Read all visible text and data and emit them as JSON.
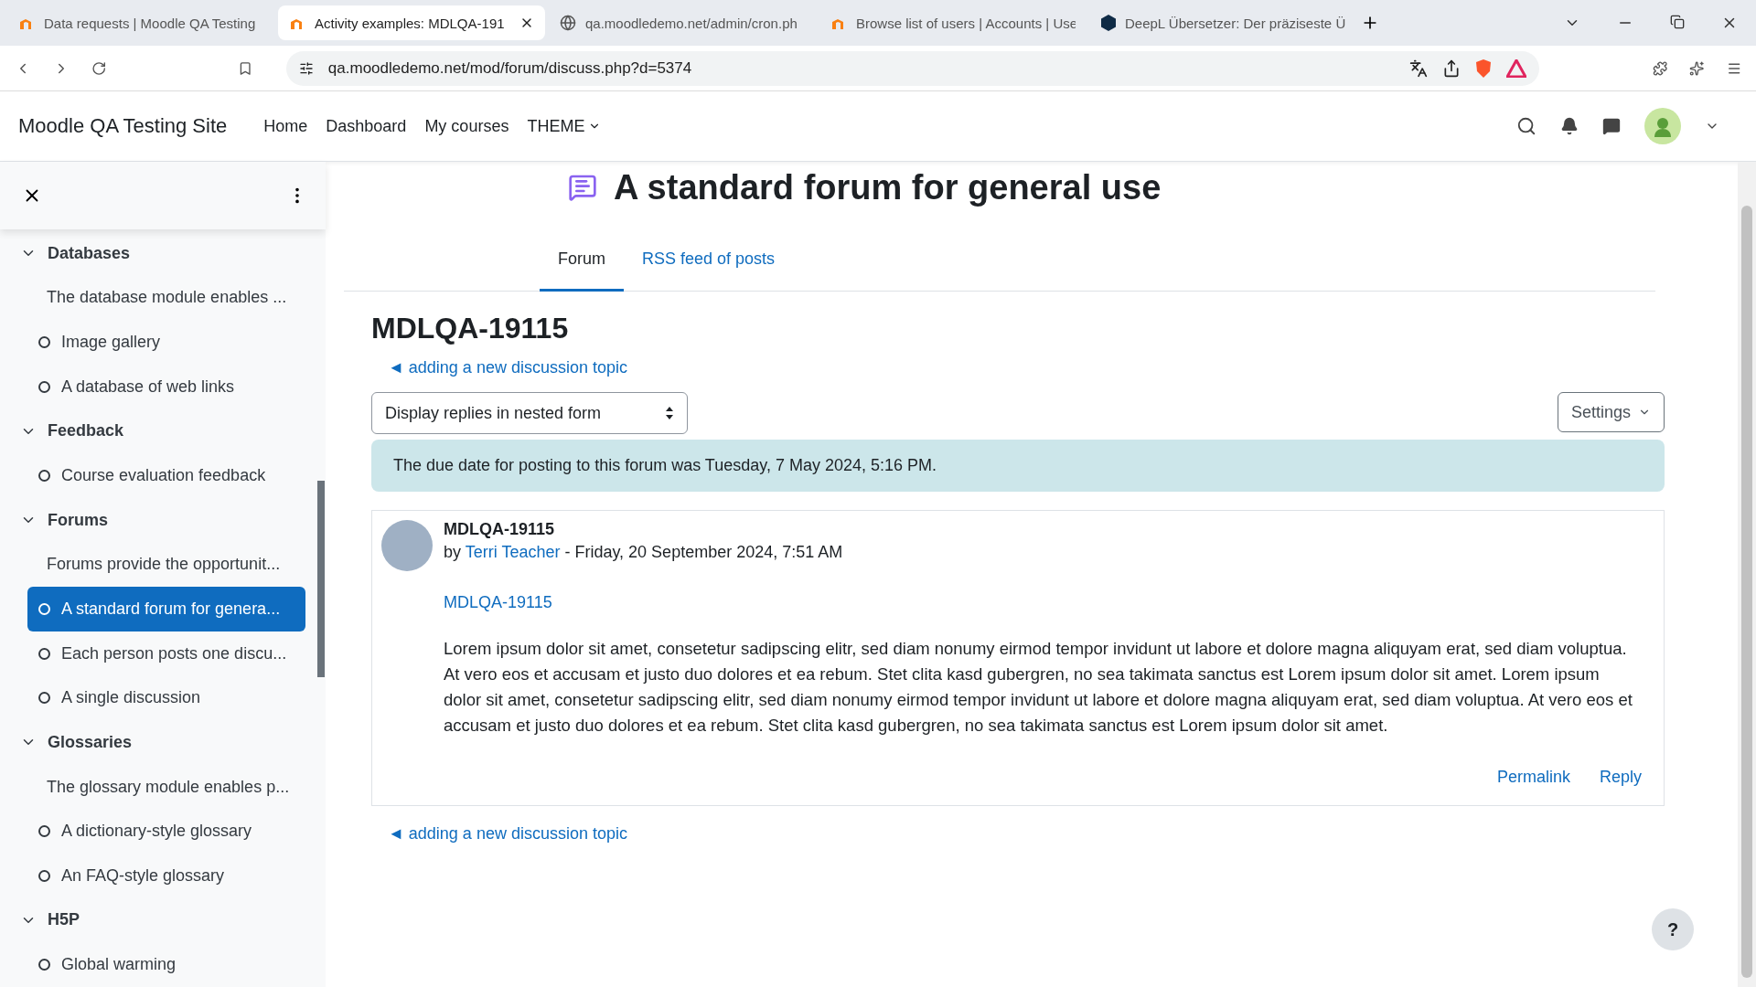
{
  "browser": {
    "tabs": [
      {
        "title": "Data requests | Moodle QA Testing",
        "selected": false
      },
      {
        "title": "Activity examples: MDLQA-191",
        "selected": true
      },
      {
        "title": "qa.moodledemo.net/admin/cron.ph",
        "selected": false
      },
      {
        "title": "Browse list of users | Accounts | Use",
        "selected": false
      },
      {
        "title": "DeepL Übersetzer: Der präziseste Ü",
        "selected": false
      }
    ],
    "url": "qa.moodledemo.net/mod/forum/discuss.php?d=5374"
  },
  "navbar": {
    "site_name": "Moodle QA Testing Site",
    "links": [
      {
        "label": "Home",
        "dropdown": false
      },
      {
        "label": "Dashboard",
        "dropdown": false
      },
      {
        "label": "My courses",
        "dropdown": false
      },
      {
        "label": "THEME",
        "dropdown": true
      }
    ]
  },
  "sidebar": {
    "sections": [
      {
        "title": "Databases",
        "expanded": true,
        "items": [
          {
            "kind": "description",
            "label": "The database module enables ...",
            "selected": false
          },
          {
            "kind": "activity",
            "label": "Image gallery",
            "selected": false
          },
          {
            "kind": "activity",
            "label": "A database of web links",
            "selected": false
          }
        ]
      },
      {
        "title": "Feedback",
        "expanded": true,
        "items": [
          {
            "kind": "activity",
            "label": "Course evaluation feedback",
            "selected": false
          }
        ]
      },
      {
        "title": "Forums",
        "expanded": true,
        "items": [
          {
            "kind": "description",
            "label": "Forums provide the opportunit...",
            "selected": false
          },
          {
            "kind": "activity",
            "label": "A standard forum for genera...",
            "selected": true
          },
          {
            "kind": "activity",
            "label": "Each person posts one discu...",
            "selected": false
          },
          {
            "kind": "activity",
            "label": "A single discussion",
            "selected": false
          }
        ]
      },
      {
        "title": "Glossaries",
        "expanded": true,
        "items": [
          {
            "kind": "description",
            "label": "The glossary module enables p...",
            "selected": false
          },
          {
            "kind": "activity",
            "label": "A dictionary-style glossary",
            "selected": false
          },
          {
            "kind": "activity",
            "label": "An FAQ-style glossary",
            "selected": false
          }
        ]
      },
      {
        "title": "H5P",
        "expanded": true,
        "items": [
          {
            "kind": "activity",
            "label": "Global warming",
            "selected": false
          }
        ]
      }
    ]
  },
  "page": {
    "title": "A standard forum for general use",
    "tabs": [
      {
        "label": "Forum",
        "selected": true
      },
      {
        "label": "RSS feed of posts",
        "selected": false
      }
    ],
    "discussion_title": "MDLQA-19115",
    "top_link": "◄ adding a new discussion topic",
    "display_mode": "Display replies in nested form",
    "settings_button": "Settings",
    "alert": "The due date for posting to this forum was Tuesday, 7 May 2024, 5:16 PM.",
    "post": {
      "subject": "MDLQA-19115",
      "by": "by",
      "author": "Terri Teacher",
      "date": " - Friday, 20 September 2024, 7:51 AM",
      "link": "MDLQA-19115",
      "body": "Lorem ipsum dolor sit amet, consetetur sadipscing elitr, sed diam nonumy eirmod tempor invidunt ut labore et dolore magna aliquyam erat, sed diam voluptua. At vero eos et accusam et justo duo dolores et ea rebum. Stet clita kasd gubergren, no sea takimata sanctus est Lorem ipsum dolor sit amet. Lorem ipsum dolor sit amet, consetetur sadipscing elitr, sed diam nonumy eirmod tempor invidunt ut labore et dolore magna aliquyam erat, sed diam voluptua. At vero eos et accusam et justo duo dolores et ea rebum. Stet clita kasd gubergren, no sea takimata sanctus est Lorem ipsum dolor sit amet.",
      "actions": [
        "Permalink",
        "Reply"
      ]
    },
    "bottom_link": "◄ adding a new discussion topic",
    "help_button": "?"
  }
}
